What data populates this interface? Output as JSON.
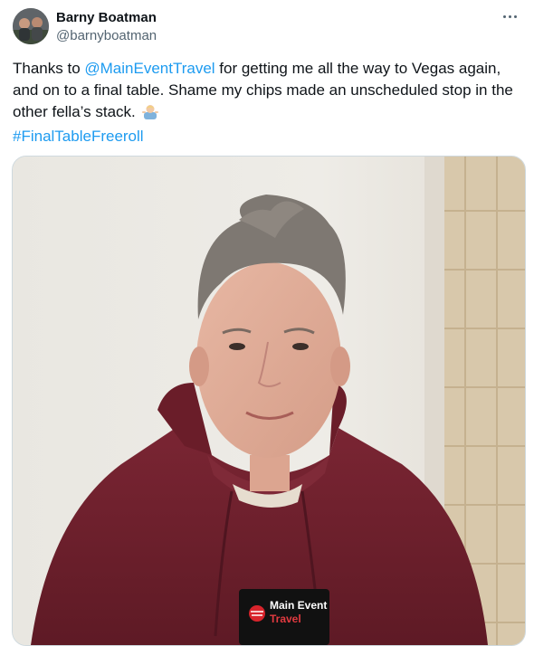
{
  "author": {
    "display_name": "Barny Boatman",
    "handle": "@barnyboatman"
  },
  "tweet": {
    "text_1": "Thanks to ",
    "mention": "@MainEventTravel",
    "text_2": " for getting me all the way to Vegas again, and on to a final table. Shame my chips made an unscheduled stop in the other fella’s stack.",
    "hashtag": "#FinalTableFreeroll"
  },
  "media": {
    "badge_line1": "Main Event",
    "badge_line2": "Travel"
  },
  "colors": {
    "link": "#1d9bf0",
    "hoodie": "#6e1f2b",
    "secondary_text": "#536471"
  },
  "icons": {
    "more": "more-horizontal-icon",
    "emoji": "man-shrugging-emoji"
  }
}
